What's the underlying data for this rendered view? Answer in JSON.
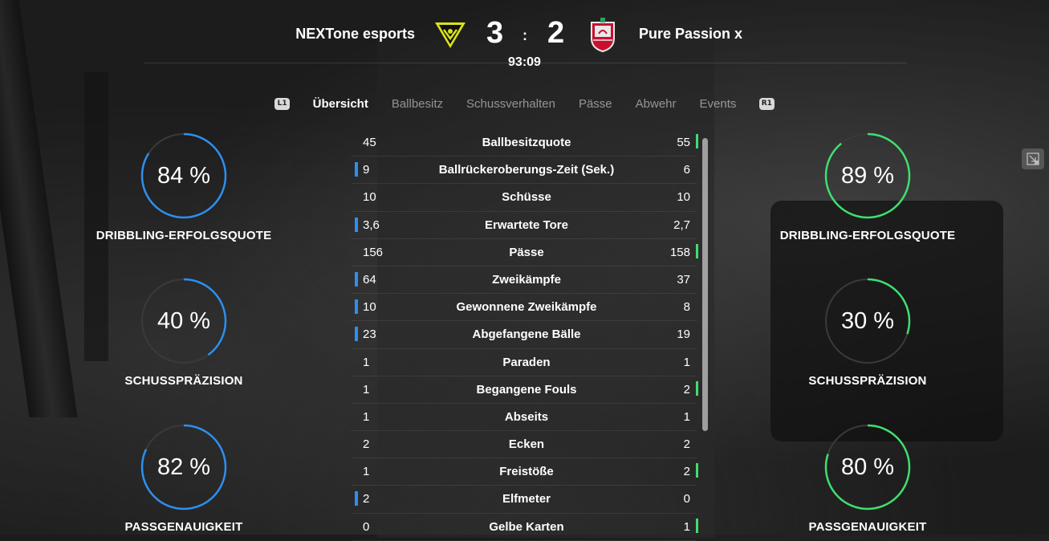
{
  "match": {
    "home_team": "NEXTone esports",
    "away_team": "Pure Passion x",
    "home_score": "3",
    "separator": ":",
    "away_score": "2",
    "clock": "93:09"
  },
  "tabs": {
    "prev_button": "L1",
    "next_button": "R1",
    "items": [
      "Übersicht",
      "Ballbesitz",
      "Schussverhalten",
      "Pässe",
      "Abwehr",
      "Events"
    ],
    "active_index": 0
  },
  "colors": {
    "home_accent": "#2d8ff0",
    "away_accent": "#3fdf6f"
  },
  "home_rings": [
    {
      "value": "84 %",
      "fraction": 0.84,
      "label": "DRIBBLING-ERFOLGSQUOTE"
    },
    {
      "value": "40 %",
      "fraction": 0.4,
      "label": "SCHUSSPRÄZISION"
    },
    {
      "value": "82 %",
      "fraction": 0.82,
      "label": "PASSGENAUIGKEIT"
    }
  ],
  "away_rings": [
    {
      "value": "89 %",
      "fraction": 0.89,
      "label": "DRIBBLING-ERFOLGSQUOTE"
    },
    {
      "value": "30 %",
      "fraction": 0.3,
      "label": "SCHUSSPRÄZISION"
    },
    {
      "value": "80 %",
      "fraction": 0.8,
      "label": "PASSGENAUIGKEIT"
    }
  ],
  "stats": [
    {
      "name": "Ballbesitzquote",
      "home": "45",
      "away": "55",
      "leader": "away"
    },
    {
      "name": "Ballrückeroberungs-Zeit (Sek.)",
      "home": "9",
      "away": "6",
      "leader": "home"
    },
    {
      "name": "Schüsse",
      "home": "10",
      "away": "10",
      "leader": "none"
    },
    {
      "name": "Erwartete Tore",
      "home": "3,6",
      "away": "2,7",
      "leader": "home"
    },
    {
      "name": "Pässe",
      "home": "156",
      "away": "158",
      "leader": "away"
    },
    {
      "name": "Zweikämpfe",
      "home": "64",
      "away": "37",
      "leader": "home"
    },
    {
      "name": "Gewonnene Zweikämpfe",
      "home": "10",
      "away": "8",
      "leader": "home"
    },
    {
      "name": "Abgefangene Bälle",
      "home": "23",
      "away": "19",
      "leader": "home"
    },
    {
      "name": "Paraden",
      "home": "1",
      "away": "1",
      "leader": "none"
    },
    {
      "name": "Begangene Fouls",
      "home": "1",
      "away": "2",
      "leader": "away"
    },
    {
      "name": "Abseits",
      "home": "1",
      "away": "1",
      "leader": "none"
    },
    {
      "name": "Ecken",
      "home": "2",
      "away": "2",
      "leader": "none"
    },
    {
      "name": "Freistöße",
      "home": "1",
      "away": "2",
      "leader": "away"
    },
    {
      "name": "Elfmeter",
      "home": "2",
      "away": "0",
      "leader": "home"
    },
    {
      "name": "Gelbe Karten",
      "home": "0",
      "away": "1",
      "leader": "away"
    }
  ]
}
